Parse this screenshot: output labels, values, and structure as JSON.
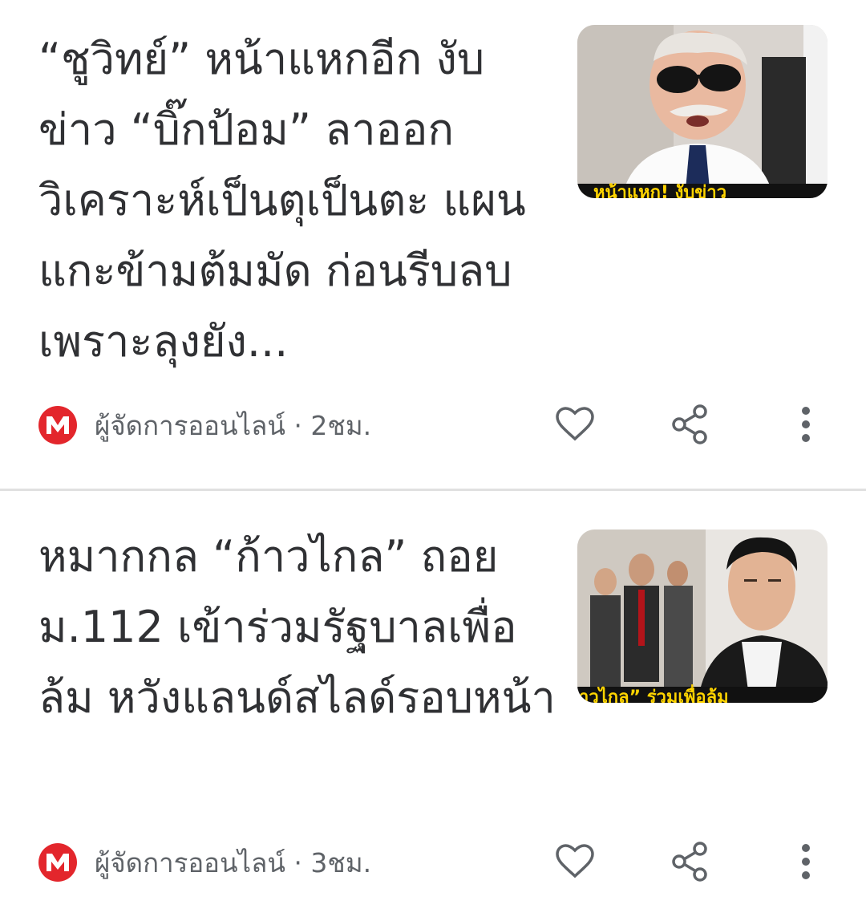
{
  "feed": {
    "items": [
      {
        "headline": "“ชูวิทย์” หน้าแหกอีก งับข่าว “บิ๊กป้อม” ลาออก วิเคราะห์เป็นตุเป็นตะ แผนแกะข้ามต้มมัด ก่อนรีบลบเพราะลุงยัง...",
        "thumbnail_caption": "หน้าแหก! งับข่าว",
        "source": "ผู้จัดการออนไลน์",
        "separator": "·",
        "time": "2ชม.",
        "actions": {
          "like_icon": "heart-outline-icon",
          "share_icon": "share-icon",
          "more_icon": "more-vert-icon"
        }
      },
      {
        "headline": "หมากกล “ก้าวไกล” ถอย ม.112 เข้าร่วมรัฐบาลเพื่อล้ม หวังแลนด์สไลด์รอบหน้า",
        "thumbnail_caption": "าวไกล” ร่วมเพื่อล้ม",
        "source": "ผู้จัดการออนไลน์",
        "separator": "·",
        "time": "3ชม.",
        "actions": {
          "like_icon": "heart-outline-icon",
          "share_icon": "share-icon",
          "more_icon": "more-vert-icon"
        }
      }
    ]
  },
  "colors": {
    "headline": "#303134",
    "meta": "#5f6368",
    "logo": "#e3262c",
    "divider": "#e0e0e0",
    "caption": "#ffd400"
  }
}
